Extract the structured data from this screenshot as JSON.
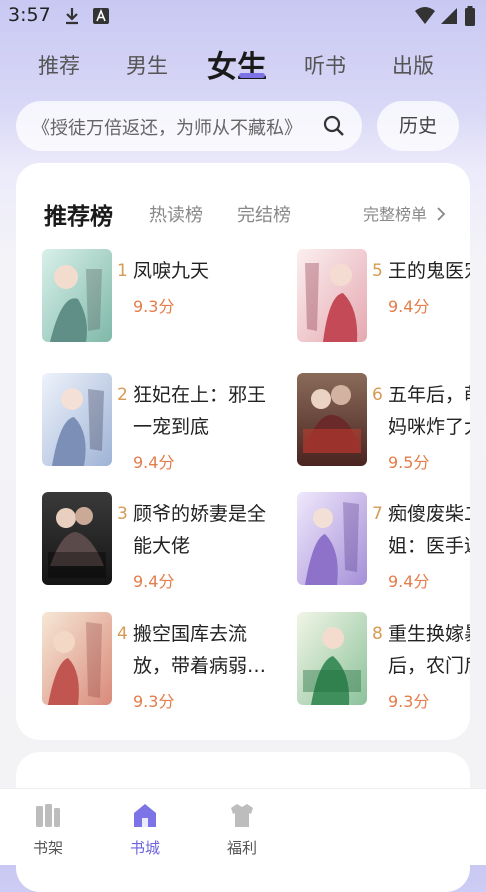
{
  "status_bar": {
    "time": "3:57"
  },
  "top_tabs": [
    {
      "label": "推荐"
    },
    {
      "label": "男生"
    },
    {
      "label": "女生"
    },
    {
      "label": "听书"
    },
    {
      "label": "出版"
    }
  ],
  "active_tab": "女生",
  "search": {
    "text": "《授徒万倍返还，为师从不藏私》"
  },
  "history_button": "历史",
  "ranking": {
    "title": "推荐榜",
    "tabs": [
      {
        "label": "热读榜"
      },
      {
        "label": "完结榜"
      }
    ],
    "more_label": "完整榜单",
    "books": [
      {
        "rank": "1",
        "title_lines": [
          "凤唳九天"
        ],
        "score": "9.3分"
      },
      {
        "rank": "2",
        "title_lines": [
          "狂妃在上：邪王",
          "一宠到底"
        ],
        "score": "9.4分"
      },
      {
        "rank": "3",
        "title_lines": [
          "顾爷的娇妻是全",
          "能大佬"
        ],
        "score": "9.4分"
      },
      {
        "rank": "4",
        "title_lines": [
          "搬空国库去流",
          "放，带着病弱…"
        ],
        "score": "9.3分"
      },
      {
        "rank": "5",
        "title_lines": [
          "王的鬼医宠"
        ],
        "score": "9.4分"
      },
      {
        "rank": "6",
        "title_lines": [
          "五年后，萌宝",
          "妈咪炸了大佬"
        ],
        "score": "9.5分"
      },
      {
        "rank": "7",
        "title_lines": [
          "痴傻废柴二小",
          "姐：医手遮天"
        ],
        "score": "9.4分"
      },
      {
        "rank": "8",
        "title_lines": [
          "重生换嫁暴君",
          "后，农门后娘"
        ],
        "score": "9.3分"
      }
    ]
  },
  "bottom_nav": [
    {
      "label": "书架",
      "icon": "bookshelf-icon"
    },
    {
      "label": "书城",
      "icon": "bookstore-icon"
    },
    {
      "label": "福利",
      "icon": "gift-icon"
    }
  ],
  "colors": {
    "accent": "#6d63e0",
    "score": "#e37d4a",
    "rank": "#d79a55"
  }
}
